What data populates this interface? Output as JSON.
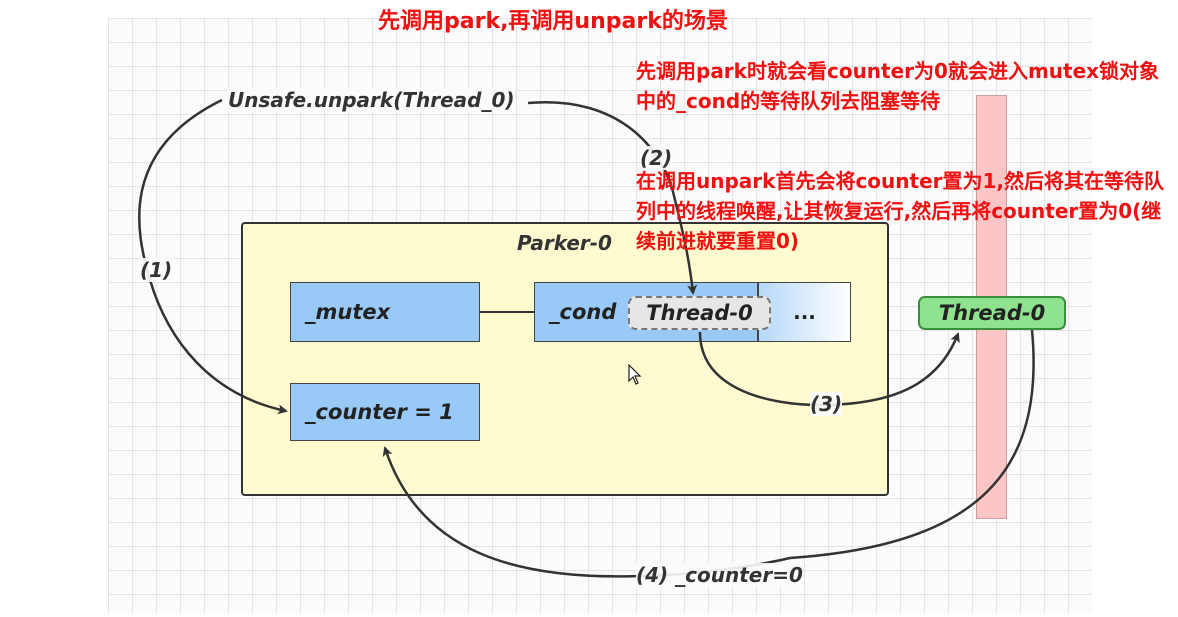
{
  "title": "先调用park,再调用unpark的场景",
  "notes": {
    "park_note": "先调用park时就会看counter为0就会进入mutex锁对象中的_cond的等待队列去阻塞等待",
    "unpark_note": "在调用unpark首先会将counter置为1,然后将其在等待队列中的线程唤醒,让其恢复运行,然后再将counter置为0(继续前进就要重置0)"
  },
  "diagram": {
    "call_label": "Unsafe.unpark(Thread_0)",
    "parker_label": "Parker-0",
    "mutex_label": "_mutex",
    "cond_label": "_cond",
    "waiting_thread": "Thread-0",
    "queue_more": "...",
    "counter_label": "_counter = 1",
    "running_thread": "Thread-0",
    "step1": "(1)",
    "step2": "(2)",
    "step3": "(3)",
    "step4": "(4) _counter=0"
  },
  "colors": {
    "title_red": "#ee1111",
    "parker_bg": "#fefbd0",
    "box_blue": "#99c9f7",
    "thread_green": "#8fe38f",
    "bar_pink": "#fcc6c6"
  }
}
